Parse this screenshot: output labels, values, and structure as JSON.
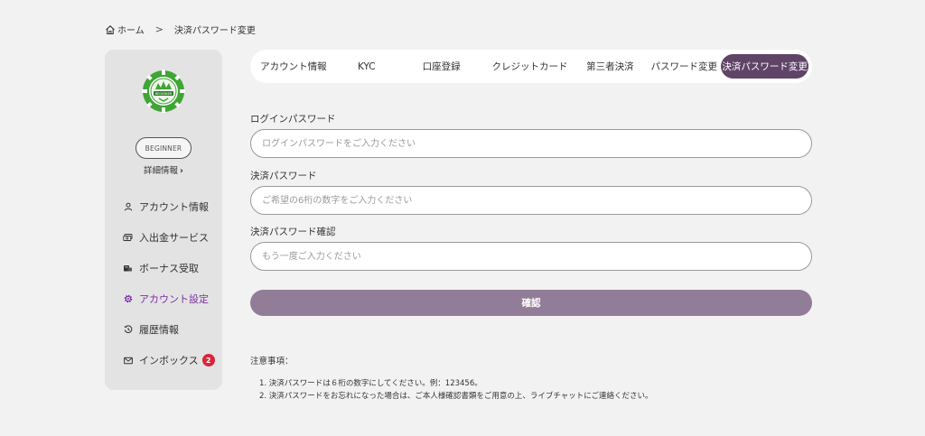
{
  "breadcrumb": {
    "home": "ホーム",
    "separator": ">",
    "current": "決済パスワード変更"
  },
  "sidebar": {
    "badge_text": "BEGINNER",
    "level": "BEGINNER",
    "detail_link": "詳細情報",
    "menu": [
      {
        "label": "アカウント情報",
        "icon": "user-icon"
      },
      {
        "label": "入出金サービス",
        "icon": "money-icon"
      },
      {
        "label": "ボーナス受取",
        "icon": "coins-icon"
      },
      {
        "label": "アカウント設定",
        "icon": "gear-icon",
        "active": true
      },
      {
        "label": "履歴情報",
        "icon": "history-icon"
      },
      {
        "label": "インボックス",
        "icon": "mail-icon",
        "count": "2"
      }
    ]
  },
  "tabs": [
    {
      "label": "アカウント情報"
    },
    {
      "label": "KYC"
    },
    {
      "label": "口座登録"
    },
    {
      "label": "クレジットカード"
    },
    {
      "label": "第三者決済"
    },
    {
      "label": "パスワード変更"
    },
    {
      "label": "決済パスワード変更",
      "active": true
    }
  ],
  "form": {
    "login_password": {
      "label": "ログインパスワード",
      "placeholder": "ログインパスワードをご入力ください",
      "value": ""
    },
    "payment_password": {
      "label": "決済パスワード",
      "placeholder": "ご希望の6桁の数字をご入力ください",
      "value": ""
    },
    "payment_password_confirm": {
      "label": "決済パスワード確認",
      "placeholder": "もう一度ご入力ください",
      "value": ""
    },
    "submit_label": "確認"
  },
  "notes": {
    "title": "注意事項：",
    "items": [
      "1. 決済パスワードは６桁の数字にしてください。例：123456。",
      "2. 決済パスワードをお忘れになった場合は、ご本人様確認書類をご用意の上、ライブチャットにご連絡ください。"
    ]
  },
  "colors": {
    "background": "#f2f2f2",
    "sidebar": "#e3e3e3",
    "accent_active_tab": "#5f4468",
    "button": "#927d99",
    "active_menu": "#7b2fa3",
    "badge_red": "#d9263a",
    "badge_green": "#3fa535"
  }
}
